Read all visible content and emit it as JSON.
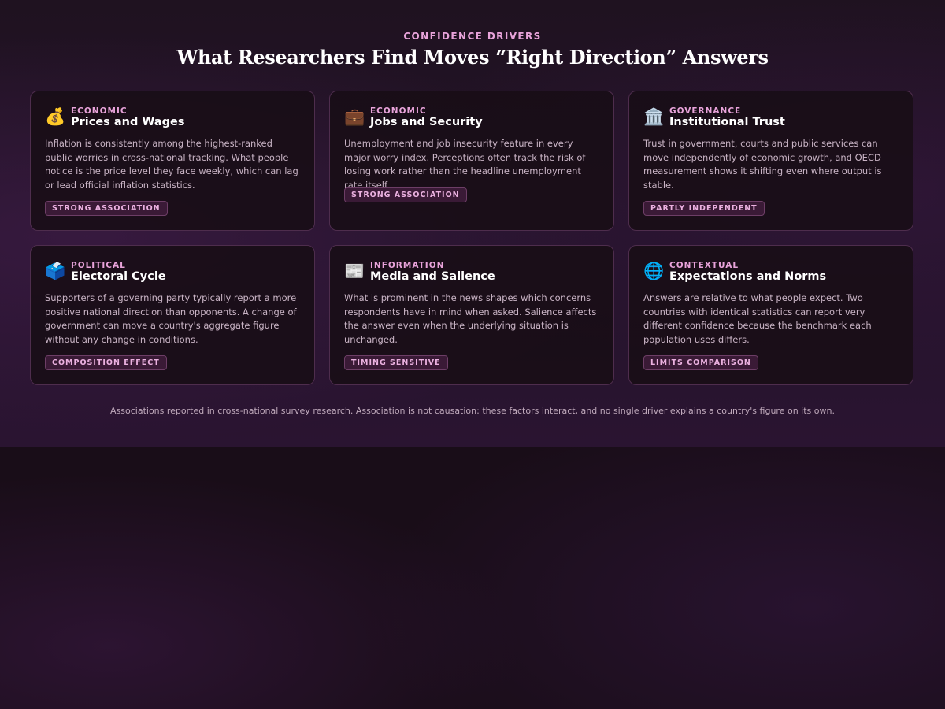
{
  "header": {
    "eyebrow": "CONFIDENCE DRIVERS",
    "title": "What Researchers Find Moves “Right Direction” Answers"
  },
  "cards": [
    {
      "icon": "money-bag-icon",
      "icon_glyph": "💰",
      "category": "ECONOMIC",
      "title": "Prices and Wages",
      "body": "Inflation is consistently among the highest-ranked public worries in cross-national tracking. What people notice is the price level they face weekly, which can lag or lead official inflation statistics.",
      "badge": "STRONG ASSOCIATION"
    },
    {
      "icon": "briefcase-icon",
      "icon_glyph": "💼",
      "category": "ECONOMIC",
      "title": "Jobs and Security",
      "body": "Unemployment and job insecurity feature in every major worry index. Perceptions often track the risk of losing work rather than the headline unemployment rate itself.",
      "badge": "STRONG ASSOCIATION"
    },
    {
      "icon": "classical-building-icon",
      "icon_glyph": "🏛️",
      "category": "GOVERNANCE",
      "title": "Institutional Trust",
      "body": "Trust in government, courts and public services can move independently of economic growth, and OECD measurement shows it shifting even where output is stable.",
      "badge": "PARTLY INDEPENDENT"
    },
    {
      "icon": "ballot-box-icon",
      "icon_glyph": "🗳️",
      "category": "POLITICAL",
      "title": "Electoral Cycle",
      "body": "Supporters of a governing party typically report a more positive national direction than opponents. A change of government can move a country's aggregate figure without any change in conditions.",
      "badge": "COMPOSITION EFFECT"
    },
    {
      "icon": "newspaper-icon",
      "icon_glyph": "📰",
      "category": "INFORMATION",
      "title": "Media and Salience",
      "body": "What is prominent in the news shapes which concerns respondents have in mind when asked. Salience affects the answer even when the underlying situation is unchanged.",
      "badge": "TIMING SENSITIVE"
    },
    {
      "icon": "globe-icon",
      "icon_glyph": "🌐",
      "category": "CONTEXTUAL",
      "title": "Expectations and Norms",
      "body": "Answers are relative to what people expect. Two countries with identical statistics can report very different confidence because the benchmark each population uses differs.",
      "badge": "LIMITS COMPARISON"
    }
  ],
  "footnote": "Associations reported in cross-national survey research. Association is not causation: these factors interact, and no single driver explains a country's figure on its own."
}
